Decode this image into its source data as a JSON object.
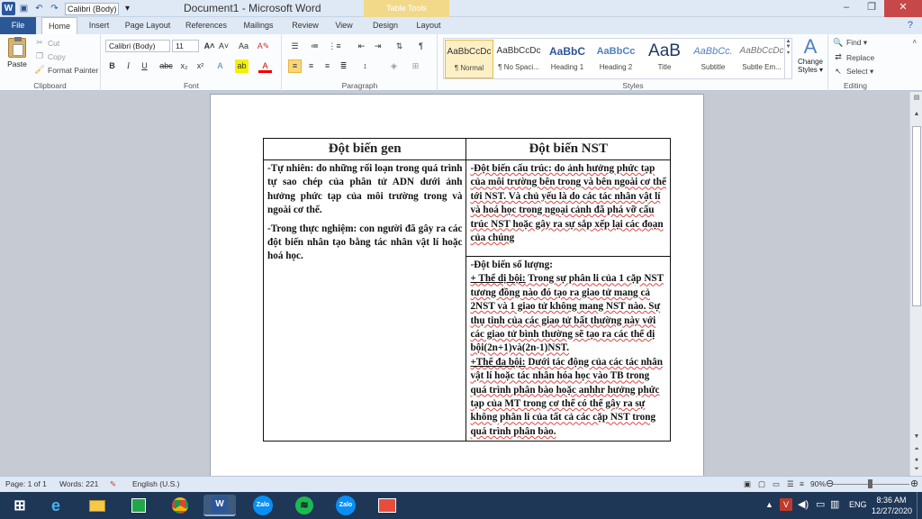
{
  "titlebar": {
    "font_name": "Calibri (Body)",
    "title": "Document1 - Microsoft Word",
    "context_tab": "Table Tools",
    "minimize": "–",
    "maximize": "❐",
    "close": "✕"
  },
  "tabs": {
    "file": "File",
    "home": "Home",
    "insert": "Insert",
    "page_layout": "Page Layout",
    "references": "References",
    "mailings": "Mailings",
    "review": "Review",
    "view": "View",
    "design": "Design",
    "layout": "Layout",
    "help": "?"
  },
  "ribbon": {
    "clipboard": {
      "label": "Clipboard",
      "paste": "Paste",
      "cut": "Cut",
      "copy": "Copy",
      "format_painter": "Format Painter"
    },
    "font": {
      "label": "Font",
      "family": "Calibri (Body)",
      "size": "11"
    },
    "paragraph": {
      "label": "Paragraph"
    },
    "styles": {
      "label": "Styles",
      "items": [
        {
          "sample": "AaBbCcDc",
          "name": "¶ Normal"
        },
        {
          "sample": "AaBbCcDc",
          "name": "¶ No Spaci..."
        },
        {
          "sample": "AaBbC",
          "name": "Heading 1"
        },
        {
          "sample": "AaBbCc",
          "name": "Heading 2"
        },
        {
          "sample": "AaB",
          "name": "Title"
        },
        {
          "sample": "AaBbCc.",
          "name": "Subtitle"
        },
        {
          "sample": "AaBbCcDc",
          "name": "Subtle Em..."
        }
      ],
      "change_styles": "Change Styles ▾"
    },
    "editing": {
      "label": "Editing",
      "find": "Find ▾",
      "replace": "Replace",
      "select": "Select ▾"
    }
  },
  "document": {
    "table": {
      "headers": [
        "Đột biến gen",
        "Đột biến NST"
      ],
      "gen_p1": "-Tự nhiên: do những rối loạn trong quá trình tự sao chép của phân tử ADN dưới ảnh hưởng phức tạp của môi trường trong và ngoài cơ thể.",
      "gen_p2": "-Trong thực nghiệm: con người đã gây ra các đột biến nhân tạo bằng tác nhân vật lí hoặc hoá học.",
      "nst_struct": "-Đột biến cấu trúc: do ảnh hưởng phức tạp của môi trường bên trong và bên ngoài cơ thể tới NST. Và chủ yếu là do các tác nhân vật lí và hoá học trong ngoại cảnh đã phá vỡ cấu trúc NST hoặc gây ra sự sắp xếp lại các đoạn của chúng",
      "nst_count_title": "-Đột biến số lượng:",
      "di_boi_label": "+ Thể dị bội:",
      "di_boi_text": " Trong sự phân li của 1 cặp NST tương đồng nào đó tạo ra giao tử mang cả 2NST và 1 giao tử không mang NST nào. Sự thụ tinh của các giao tử bất thường này với các giao tử bình thường sẽ tạo ra các thể dị bội(2n+1)và(2n-1)NST.",
      "da_boi_label": "+Thể đa bội:",
      "da_boi_text": " Dưới tác động của các tác nhân vật lí hoặc tác nhân hóa học vào TB trong quá trình phân bào hoặc anhhr hưởng  phức tạp của MT trong cơ thể có thể gây ra sự không phân li của tất cả các cặp NST trong quá trình phân bào."
    }
  },
  "statusbar": {
    "page": "Page: 1 of 1",
    "words": "Words: 221",
    "language": "English (U.S.)",
    "zoom": "90%"
  },
  "taskbar": {
    "zalo1": "Zalo",
    "zalo2": "Zalo",
    "lang": "ENG",
    "time": "8:36 AM",
    "date": "12/27/2020"
  }
}
